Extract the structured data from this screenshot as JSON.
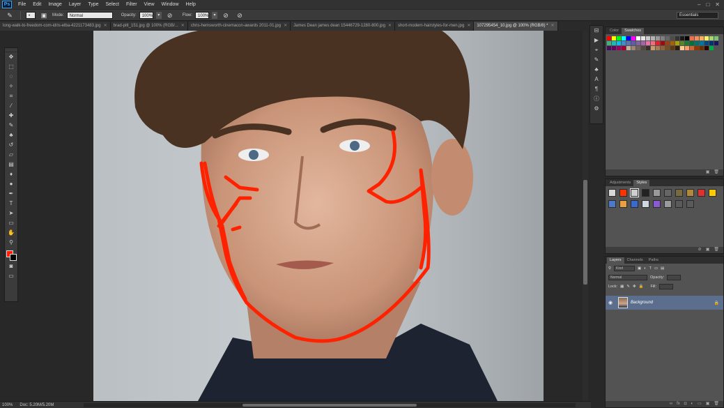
{
  "app": {
    "logo": "Ps",
    "menus": [
      "File",
      "Edit",
      "Image",
      "Layer",
      "Type",
      "Select",
      "Filter",
      "View",
      "Window",
      "Help"
    ],
    "window_controls": [
      "–",
      "□",
      "✕"
    ]
  },
  "options_bar": {
    "mode_label": "Mode:",
    "mode_value": "Normal",
    "opacity_label": "Opacity:",
    "opacity_value": "100%",
    "flow_label": "Flow:",
    "flow_value": "100%",
    "workspace": "Essentials"
  },
  "tabs": [
    {
      "label": "long-walk-to-freedom-com-idris-elba-4221173483.jpg",
      "active": false
    },
    {
      "label": "brad-pitt_151.jpg @ 100% (RGB/...",
      "active": false
    },
    {
      "label": "chris-hemsworth-cinemacon-awards 2011-01.jpg",
      "active": false
    },
    {
      "label": "James Dean james dean 15446729-1280-800.jpg",
      "active": false
    },
    {
      "label": "short-modern-hairstyles-for-men.jpg",
      "active": false
    },
    {
      "label": "107295454_10.jpg @ 100% (RGB/8) *",
      "active": true
    }
  ],
  "toolbar": {
    "tools": [
      {
        "name": "move-tool-icon",
        "glyph": "✥"
      },
      {
        "name": "marquee-tool-icon",
        "glyph": "⬚"
      },
      {
        "name": "lasso-tool-icon",
        "glyph": "◌"
      },
      {
        "name": "quick-select-tool-icon",
        "glyph": "✧"
      },
      {
        "name": "crop-tool-icon",
        "glyph": "⌗"
      },
      {
        "name": "eyedropper-tool-icon",
        "glyph": "⁄"
      },
      {
        "name": "healing-brush-tool-icon",
        "glyph": "✚"
      },
      {
        "name": "brush-tool-icon",
        "glyph": "✎"
      },
      {
        "name": "clone-stamp-tool-icon",
        "glyph": "♣"
      },
      {
        "name": "history-brush-tool-icon",
        "glyph": "↺"
      },
      {
        "name": "eraser-tool-icon",
        "glyph": "▱"
      },
      {
        "name": "gradient-tool-icon",
        "glyph": "▤"
      },
      {
        "name": "blur-tool-icon",
        "glyph": "♦"
      },
      {
        "name": "dodge-tool-icon",
        "glyph": "●"
      },
      {
        "name": "pen-tool-icon",
        "glyph": "✒"
      },
      {
        "name": "type-tool-icon",
        "glyph": "T"
      },
      {
        "name": "path-select-tool-icon",
        "glyph": "➤"
      },
      {
        "name": "shape-tool-icon",
        "glyph": "▭"
      },
      {
        "name": "hand-tool-icon",
        "glyph": "✋"
      },
      {
        "name": "zoom-tool-icon",
        "glyph": "⚲"
      }
    ],
    "foreground_color": "#ff1a00",
    "background_color": "#000000"
  },
  "status": {
    "zoom": "100%",
    "doc": "Doc: 5.20M/5.20M"
  },
  "panels": {
    "color_tabs": [
      "Color",
      "Swatches"
    ],
    "style_tabs": [
      "Adjustments",
      "Styles"
    ],
    "layer_tabs": [
      "Layers",
      "Channels",
      "Paths"
    ],
    "kind_label": "Kind",
    "blend_mode": "Normal",
    "opacity_label": "Opacity:",
    "lock_label": "Lock:",
    "fill_label": "Fill:",
    "layer_name": "Background"
  },
  "colors": {
    "accent_red": "#ff2200",
    "selected_layer": "#5b6e8d"
  }
}
